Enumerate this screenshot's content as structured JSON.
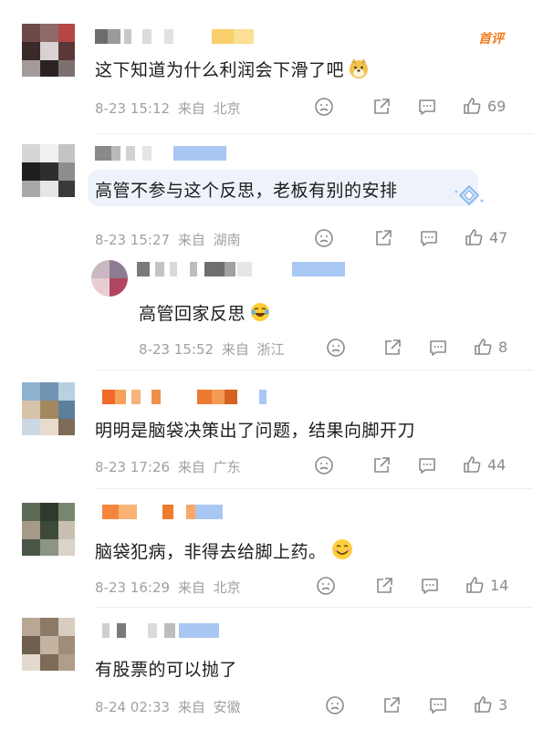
{
  "comments": [
    {
      "text": "这下知道为什么利润会下滑了吧",
      "date": "8-23 15:12",
      "from": "来自",
      "location": "北京",
      "likes": "69",
      "tag": "首评",
      "emoji": "doge-icon"
    },
    {
      "text": "高管不参与这个反思，老板有别的安排",
      "date": "8-23 15:27",
      "from": "来自",
      "location": "湖南",
      "likes": "47"
    },
    {
      "text": "高管回家反思",
      "date": "8-23 15:52",
      "from": "来自",
      "location": "浙江",
      "likes": "8",
      "emoji": "laugh-cry-icon"
    },
    {
      "text": "明明是脑袋决策出了问题，结果向脚开刀",
      "date": "8-23 17:26",
      "from": "来自",
      "location": "广东",
      "likes": "44"
    },
    {
      "text": "脑袋犯病，非得去给脚上药。",
      "date": "8-23 16:29",
      "from": "来自",
      "location": "北京",
      "likes": "14",
      "emoji": "smile-icon"
    },
    {
      "text": "有股票的可以抛了",
      "date": "8-24 02:33",
      "from": "来自",
      "location": "安徽",
      "likes": "3"
    }
  ],
  "colors": {
    "tag": "#f47c1f",
    "meta": "#a0a0a0",
    "icon": "#8a8a8a"
  }
}
